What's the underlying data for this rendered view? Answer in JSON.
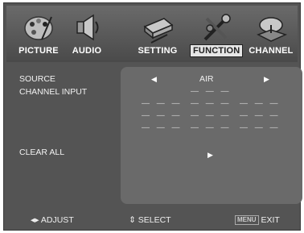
{
  "tabs": [
    {
      "label": "PICTURE",
      "icon": "palette-icon",
      "active": false
    },
    {
      "label": "AUDIO",
      "icon": "speaker-icon",
      "active": false
    },
    {
      "label": "SETTING",
      "icon": "setting-icon",
      "active": false
    },
    {
      "label": "FUNCTION",
      "icon": "tools-icon",
      "active": true
    },
    {
      "label": "CHANNEL",
      "icon": "satellite-dish-icon",
      "active": false
    }
  ],
  "menu": {
    "source_label": "SOURCE",
    "source_value": "AIR",
    "channel_input_label": "CHANNEL INPUT",
    "channel_input_top": "— — —",
    "channel_input_rows": [
      [
        "— — —",
        "— — —",
        "— — —"
      ],
      [
        "— — —",
        "— — —",
        "— — —"
      ],
      [
        "— — —",
        "— — —",
        "— — —"
      ]
    ],
    "clear_all_label": "CLEAR ALL"
  },
  "help": {
    "adjust": "ADJUST",
    "select": "SELECT",
    "menu_key": "MENU",
    "exit": "EXIT"
  },
  "colors": {
    "background": "#545454",
    "panel": "#6a6a6a",
    "text": "#f0f0f0"
  }
}
